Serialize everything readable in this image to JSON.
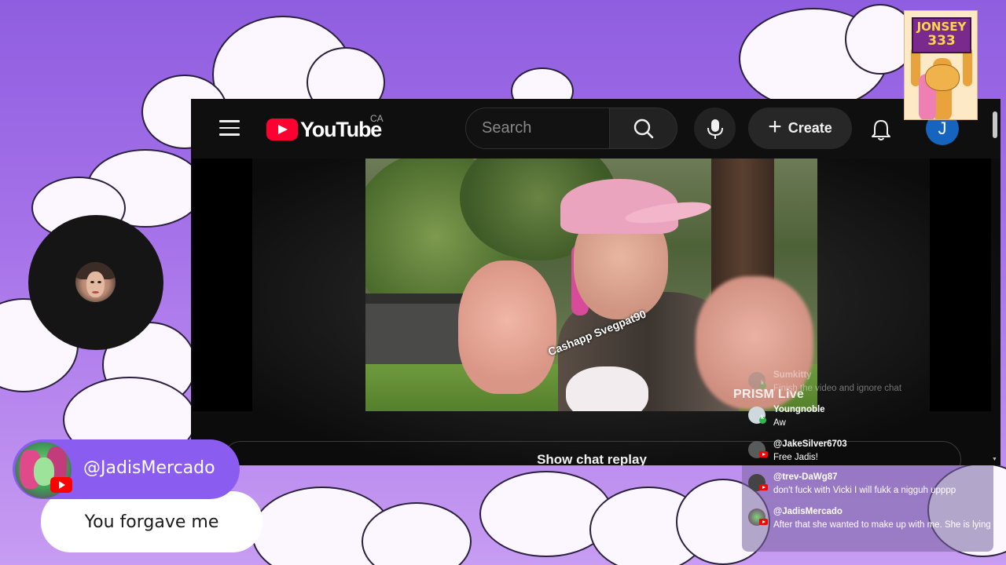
{
  "youtube": {
    "logo_text": "YouTube",
    "country_code": "CA",
    "search_placeholder": "Search",
    "create_label": "Create",
    "account_initial": "J",
    "show_chat_replay": "Show chat replay"
  },
  "video": {
    "watermark": "Cashapp Svegpat90",
    "prism_label": "PRISM Live"
  },
  "sticker": {
    "line1": "JONSEY",
    "line2": "333"
  },
  "highlight": {
    "handle": "@JadisMercado",
    "message": "You forgave me",
    "platform_icon": "youtube-icon"
  },
  "chat": {
    "messages": [
      {
        "name": "Sumkitty",
        "text": "Finish the video and ignore chat",
        "platform": "kick",
        "faded": true
      },
      {
        "name": "Youngnoble",
        "text": "Aw",
        "platform": "kick"
      },
      {
        "name": "@JakeSilver6703",
        "text": "Free Jadis!",
        "platform": "youtube"
      },
      {
        "name": "@trev-DaWg87",
        "text": "don't fuck with Vicki I will fukk a nigguh upppp",
        "platform": "youtube"
      },
      {
        "name": "@JadisMercado",
        "text": "After that she wanted to make up with me. She is lying",
        "platform": "youtube"
      }
    ]
  },
  "colors": {
    "background": "#9a66e6",
    "accent_pill": "#8a5cf0",
    "youtube_red": "#ff0033"
  }
}
